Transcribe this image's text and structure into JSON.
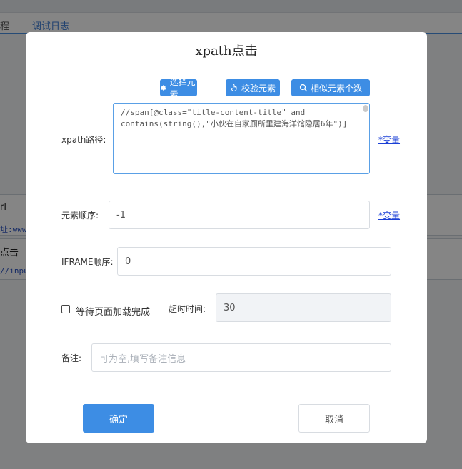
{
  "background": {
    "tab_1": "程",
    "tab_2": "调试日志",
    "panel_1_title": "rl",
    "panel_1_sub": "址:www.",
    "panel_2_title": "点击",
    "panel_2_sub": "//inpu"
  },
  "modal": {
    "title": "xpath点击",
    "toolbar": {
      "select_element": "选择元素",
      "verify_element": "校验元素",
      "similar_count": "相似元素个数"
    },
    "xpath": {
      "label": "xpath路径:",
      "value": "//span[@class=\"title-content-title\" and contains(string(),\"小伙在自家厕所里建海洋馆隐居6年\")]",
      "var_link": "*变量"
    },
    "order": {
      "label": "元素顺序:",
      "value": "-1",
      "var_link": "*变量"
    },
    "iframe": {
      "label": "IFRAME顺序:",
      "value": "0"
    },
    "wait": {
      "checkbox_label": "等待页面加载完成",
      "timeout_label": "超时时间:",
      "timeout_value": "30"
    },
    "note": {
      "label": "备注:",
      "placeholder": "可为空,填写备注信息"
    },
    "confirm": "确定",
    "cancel": "取消"
  },
  "colors": {
    "primary": "#3d8de4",
    "link": "#1a3fd6",
    "overlay": "rgba(0,0,0,0.48)"
  }
}
